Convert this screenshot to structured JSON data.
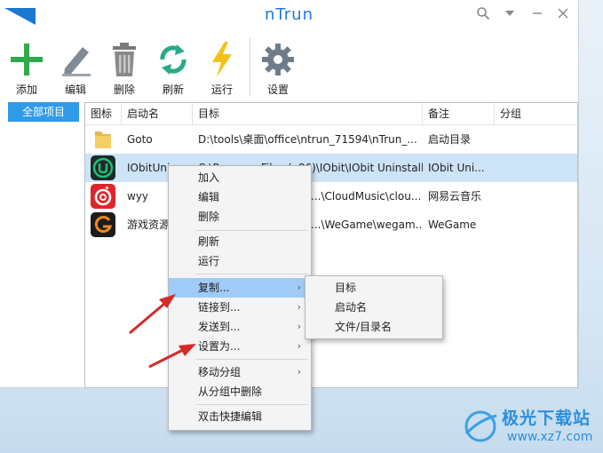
{
  "window": {
    "title": "nTrun"
  },
  "toolbar": {
    "add": "添加",
    "edit": "编辑",
    "delete": "删除",
    "refresh": "刷新",
    "run": "运行",
    "settings": "设置"
  },
  "sidebar": {
    "items": [
      {
        "label": "全部项目"
      }
    ]
  },
  "table": {
    "headers": [
      "图标",
      "启动名",
      "目标",
      "备注",
      "分组"
    ],
    "rows": [
      {
        "icon": "folder-icon",
        "name": "Goto",
        "target": "D:\\tools\\桌面\\office\\ntrun_71594\\nTrun_...",
        "note": "启动目录",
        "group": ""
      },
      {
        "icon": "iobit-icon",
        "name": "IObitUni",
        "target": "C:\\Program Files (x86)\\IObit\\IObit Uninstaller\\I...",
        "note": "IObit Uni...",
        "group": ""
      },
      {
        "icon": "netease-music-icon",
        "name": "wyy",
        "target": "...\\CloudMusic\\clou...",
        "note": "网易云音乐",
        "group": ""
      },
      {
        "icon": "wegame-icon",
        "name": "游戏资源",
        "target": "...\\WeGame\\wegam...",
        "note": "WeGame",
        "group": ""
      }
    ]
  },
  "context_menu": {
    "add": "加入",
    "edit": "编辑",
    "delete": "删除",
    "refresh": "刷新",
    "run": "运行",
    "copy": "复制...",
    "link_to": "链接到...",
    "send_to": "发送到...",
    "set_as": "设置为...",
    "move_group": "移动分组",
    "remove_from_group": "从分组中删除",
    "double_click_edit": "双击快捷编辑",
    "arrow": "›"
  },
  "submenu": {
    "target": "目标",
    "launch_name": "启动名",
    "file_dir_name": "文件/目录名"
  },
  "watermark": {
    "name": "极光下载站",
    "url": "www.xz7.com"
  },
  "colors": {
    "accent": "#2f9bea",
    "title": "#1f7ad4",
    "selection": "#cde4f8",
    "menu_highlight": "#9fcbf6",
    "arrow_red": "#d42a2a"
  }
}
